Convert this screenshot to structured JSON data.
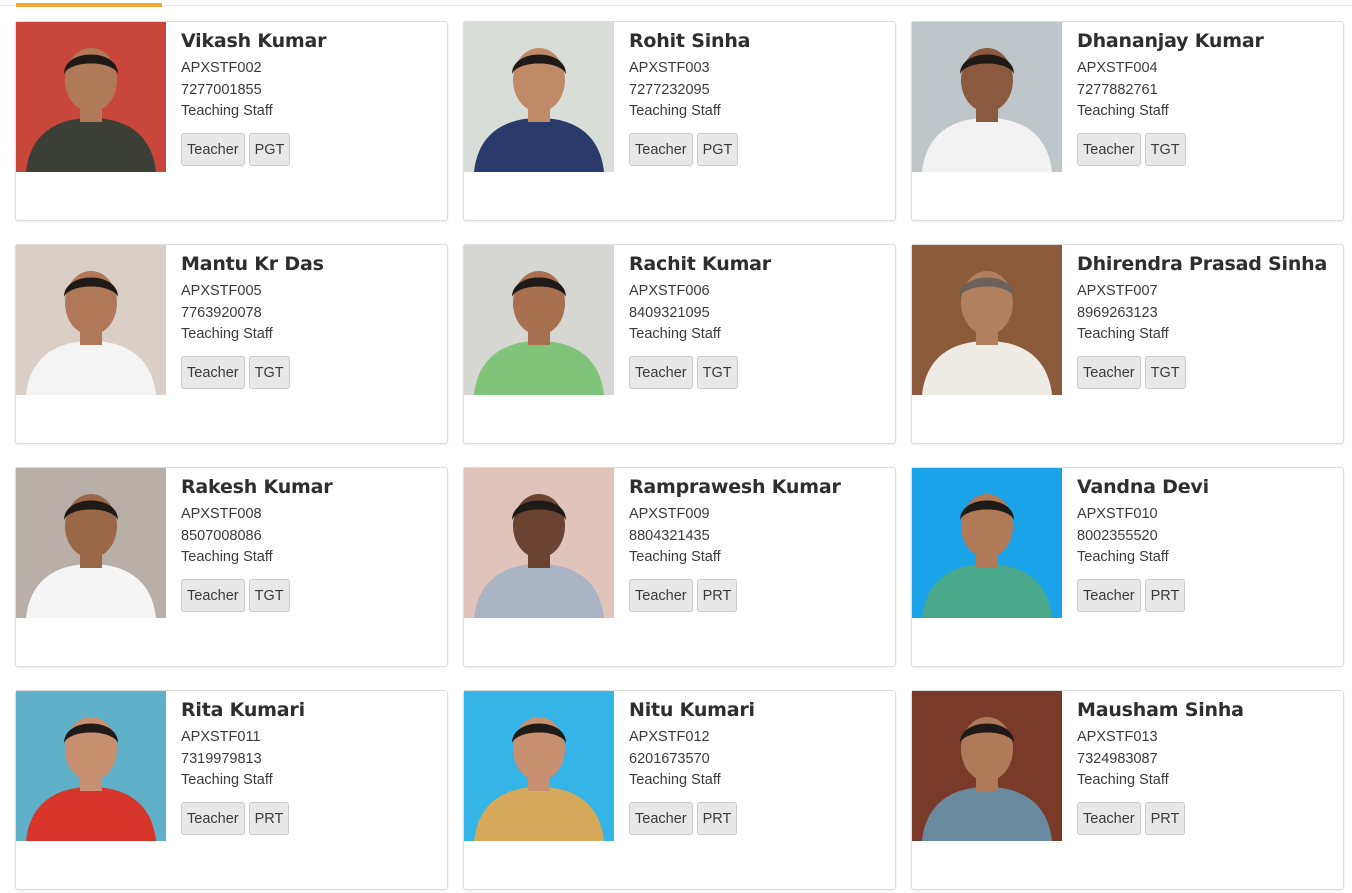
{
  "staff": [
    {
      "name": "Vikash Kumar",
      "id": "APXSTF002",
      "phone": "7277001855",
      "type": "Teaching Staff",
      "role": "Teacher",
      "grade": "PGT",
      "bg": "#c9463a",
      "shirt": "#3b3f36",
      "skin": "#b07a5a",
      "hair": "#1e1a18"
    },
    {
      "name": "Rohit Sinha",
      "id": "APXSTF003",
      "phone": "7277232095",
      "type": "Teaching Staff",
      "role": "Teacher",
      "grade": "PGT",
      "bg": "#d8ddd8",
      "shirt": "#2a3a6b",
      "skin": "#c08a68",
      "hair": "#1e1a18"
    },
    {
      "name": "Dhananjay Kumar",
      "id": "APXSTF004",
      "phone": "7277882761",
      "type": "Teaching Staff",
      "role": "Teacher",
      "grade": "TGT",
      "bg": "#bfc6c9",
      "shirt": "#f2f2f2",
      "skin": "#8a5a40",
      "hair": "#1e1a18"
    },
    {
      "name": "Mantu Kr Das",
      "id": "APXSTF005",
      "phone": "7763920078",
      "type": "Teaching Staff",
      "role": "Teacher",
      "grade": "TGT",
      "bg": "#d9cfc6",
      "shirt": "#f4f4f4",
      "skin": "#b07858",
      "hair": "#1e1a18"
    },
    {
      "name": "Rachit Kumar",
      "id": "APXSTF006",
      "phone": "8409321095",
      "type": "Teaching Staff",
      "role": "Teacher",
      "grade": "TGT",
      "bg": "#d6d6d2",
      "shirt": "#7fc47a",
      "skin": "#a87050",
      "hair": "#1e1a18"
    },
    {
      "name": "Dhirendra Prasad Sinha",
      "id": "APXSTF007",
      "phone": "8969263123",
      "type": "Teaching Staff",
      "role": "Teacher",
      "grade": "TGT",
      "bg": "#8a5a3a",
      "shirt": "#eeeae4",
      "skin": "#b08060",
      "hair": "#6a625a"
    },
    {
      "name": "Rakesh Kumar",
      "id": "APXSTF008",
      "phone": "8507008086",
      "type": "Teaching Staff",
      "role": "Teacher",
      "grade": "TGT",
      "bg": "#b8b0a8",
      "shirt": "#f5f5f5",
      "skin": "#9a6848",
      "hair": "#1e1a18"
    },
    {
      "name": "Ramprawesh Kumar",
      "id": "APXSTF009",
      "phone": "8804321435",
      "type": "Teaching Staff",
      "role": "Teacher",
      "grade": "PRT",
      "bg": "#e0c4bc",
      "shirt": "#aab4c4",
      "skin": "#6a4430",
      "hair": "#1e1a18"
    },
    {
      "name": "Vandna Devi",
      "id": "APXSTF010",
      "phone": "8002355520",
      "type": "Teaching Staff",
      "role": "Teacher",
      "grade": "PRT",
      "bg": "#1aa3e8",
      "shirt": "#4aa88a",
      "skin": "#b07a58",
      "hair": "#1e1a18"
    },
    {
      "name": "Rita Kumari",
      "id": "APXSTF011",
      "phone": "7319979813",
      "type": "Teaching Staff",
      "role": "Teacher",
      "grade": "PRT",
      "bg": "#5fb0c8",
      "shirt": "#d8352a",
      "skin": "#c89070",
      "hair": "#1e1a18"
    },
    {
      "name": "Nitu Kumari",
      "id": "APXSTF012",
      "phone": "6201673570",
      "type": "Teaching Staff",
      "role": "Teacher",
      "grade": "PRT",
      "bg": "#35b4e8",
      "shirt": "#d6a85a",
      "skin": "#c89070",
      "hair": "#1e1a18"
    },
    {
      "name": "Mausham Sinha",
      "id": "APXSTF013",
      "phone": "7324983087",
      "type": "Teaching Staff",
      "role": "Teacher",
      "grade": "PRT",
      "bg": "#7a3a2a",
      "shirt": "#6a8aa0",
      "skin": "#b07a5a",
      "hair": "#1e1a18"
    }
  ]
}
